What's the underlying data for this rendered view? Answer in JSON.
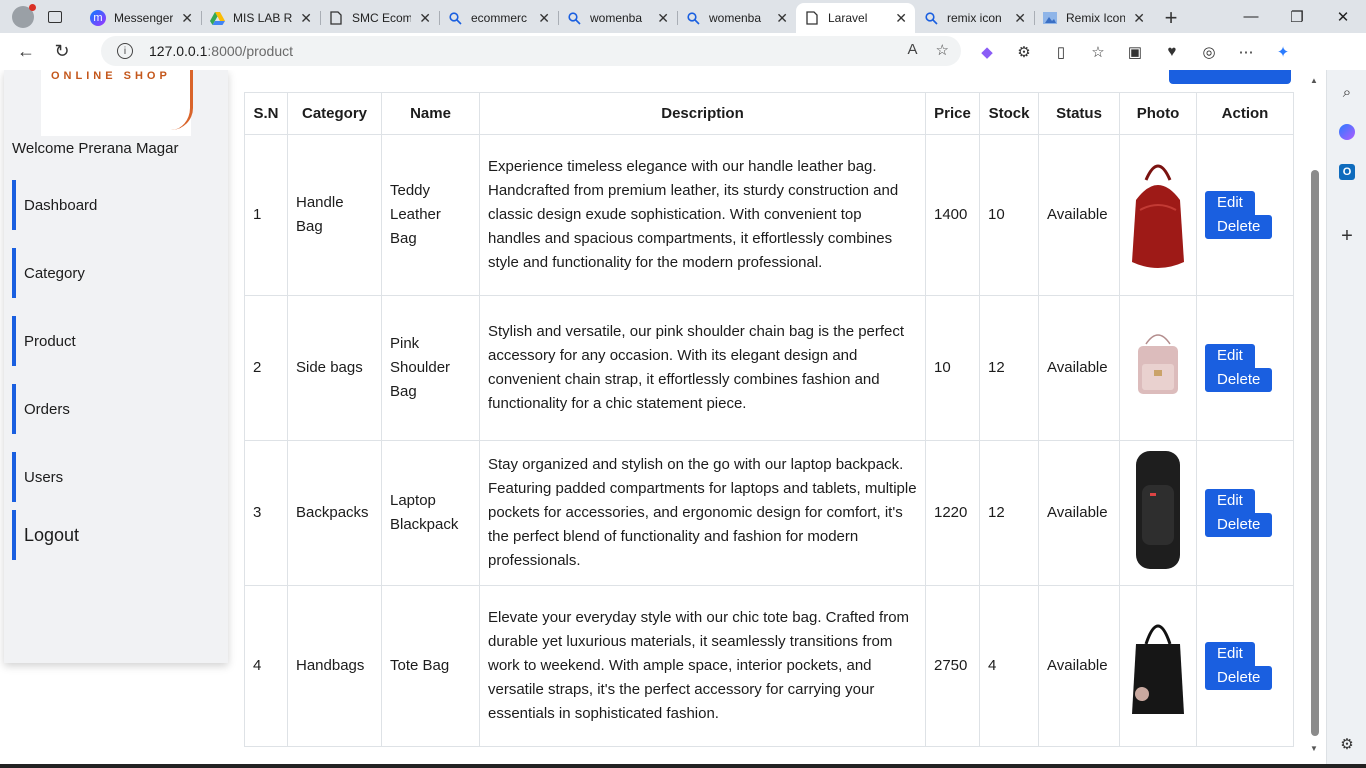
{
  "browser": {
    "tabs": [
      {
        "title": "Messenger",
        "icon": "messenger-icon",
        "active": false
      },
      {
        "title": "MIS LAB R",
        "icon": "google-drive-icon",
        "active": false
      },
      {
        "title": "SMC Ecom",
        "icon": "document-icon",
        "active": false
      },
      {
        "title": "ecommerc",
        "icon": "search-icon",
        "active": false
      },
      {
        "title": "womenba",
        "icon": "search-icon",
        "active": false
      },
      {
        "title": "womenba",
        "icon": "search-icon",
        "active": false
      },
      {
        "title": "Laravel",
        "icon": "document-icon",
        "active": true
      },
      {
        "title": "remix icon",
        "icon": "search-icon",
        "active": false
      },
      {
        "title": "Remix Icon",
        "icon": "image-icon",
        "active": false
      }
    ],
    "url_host": "127.0.0.1",
    "url_path": ":8000/product"
  },
  "sidebar": {
    "logo_text": "ONLINE SHOP",
    "welcome": "Welcome Prerana Magar",
    "items": [
      {
        "label": "Dashboard"
      },
      {
        "label": "Category"
      },
      {
        "label": "Product"
      },
      {
        "label": "Orders"
      },
      {
        "label": "Users"
      },
      {
        "label": "Logout"
      }
    ]
  },
  "table": {
    "headers": [
      "S.N",
      "Category",
      "Name",
      "Description",
      "Price",
      "Stock",
      "Status",
      "Photo",
      "Action"
    ],
    "edit_label": "Edit",
    "delete_label": "Delete",
    "rows": [
      {
        "sn": "1",
        "category": "Handle Bag",
        "name": "Teddy Leather Bag",
        "description": "Experience timeless elegance with our handle leather bag. Handcrafted from premium leather, its sturdy construction and classic design exude sophistication. With convenient top handles and spacious compartments, it effortlessly combines style and functionality for the modern professional.",
        "price": "1400",
        "stock": "10",
        "status": "Available",
        "photo_color": "#9e1a17"
      },
      {
        "sn": "2",
        "category": "Side bags",
        "name": "Pink Shoulder Bag",
        "description": "Stylish and versatile, our pink shoulder chain bag is the perfect accessory for any occasion. With its elegant design and convenient chain strap, it effortlessly combines fashion and functionality for a chic statement piece.",
        "price": "10",
        "stock": "12",
        "status": "Available",
        "photo_color": "#d9b3b3"
      },
      {
        "sn": "3",
        "category": "Backpacks",
        "name": "Laptop Blackpack",
        "description": "Stay organized and stylish on the go with our laptop backpack. Featuring padded compartments for laptops and tablets, multiple pockets for accessories, and ergonomic design for comfort, it's the perfect blend of functionality and fashion for modern professionals.",
        "price": "1220",
        "stock": "12",
        "status": "Available",
        "photo_color": "#1e1e1e"
      },
      {
        "sn": "4",
        "category": "Handbags",
        "name": "Tote Bag",
        "description": "Elevate your everyday style with our chic tote bag. Crafted from durable yet luxurious materials, it seamlessly transitions from work to weekend. With ample space, interior pockets, and versatile straps, it's the perfect accessory for carrying your essentials in sophisticated fashion.",
        "price": "2750",
        "stock": "4",
        "status": "Available",
        "photo_color": "#161616"
      }
    ]
  }
}
